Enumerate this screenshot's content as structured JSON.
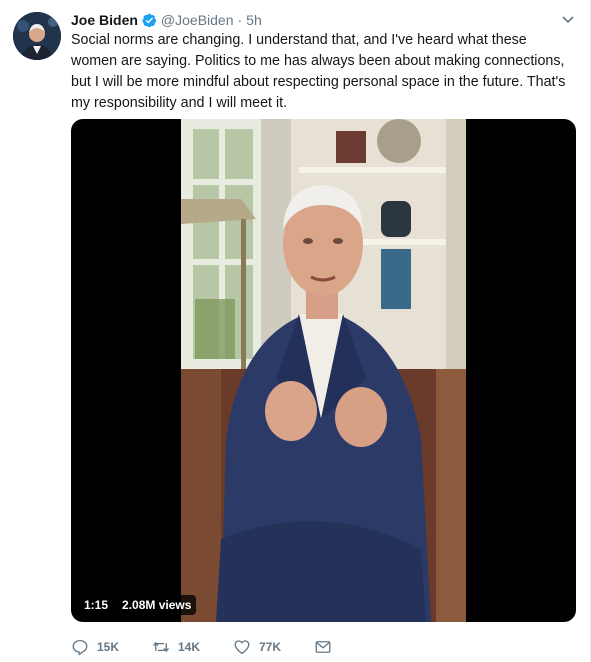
{
  "tweet": {
    "author_name": "Joe Biden",
    "handle": "@JoeBiden",
    "separator": "·",
    "time": "5h",
    "text": "Social norms are changing. I understand that, and I've heard what these women are saying. Politics to me has always been about making connections, but I will be more mindful about respecting personal space in the future. That's my responsibility and I will meet it.",
    "verified": true,
    "accent_color": "#1da1f2"
  },
  "video": {
    "duration": "1:15",
    "views": "2.08M views"
  },
  "actions": {
    "reply_count": "15K",
    "retweet_count": "14K",
    "like_count": "77K",
    "reply_icon": "reply-icon",
    "retweet_icon": "retweet-icon",
    "like_icon": "heart-icon",
    "dm_icon": "envelope-icon"
  }
}
